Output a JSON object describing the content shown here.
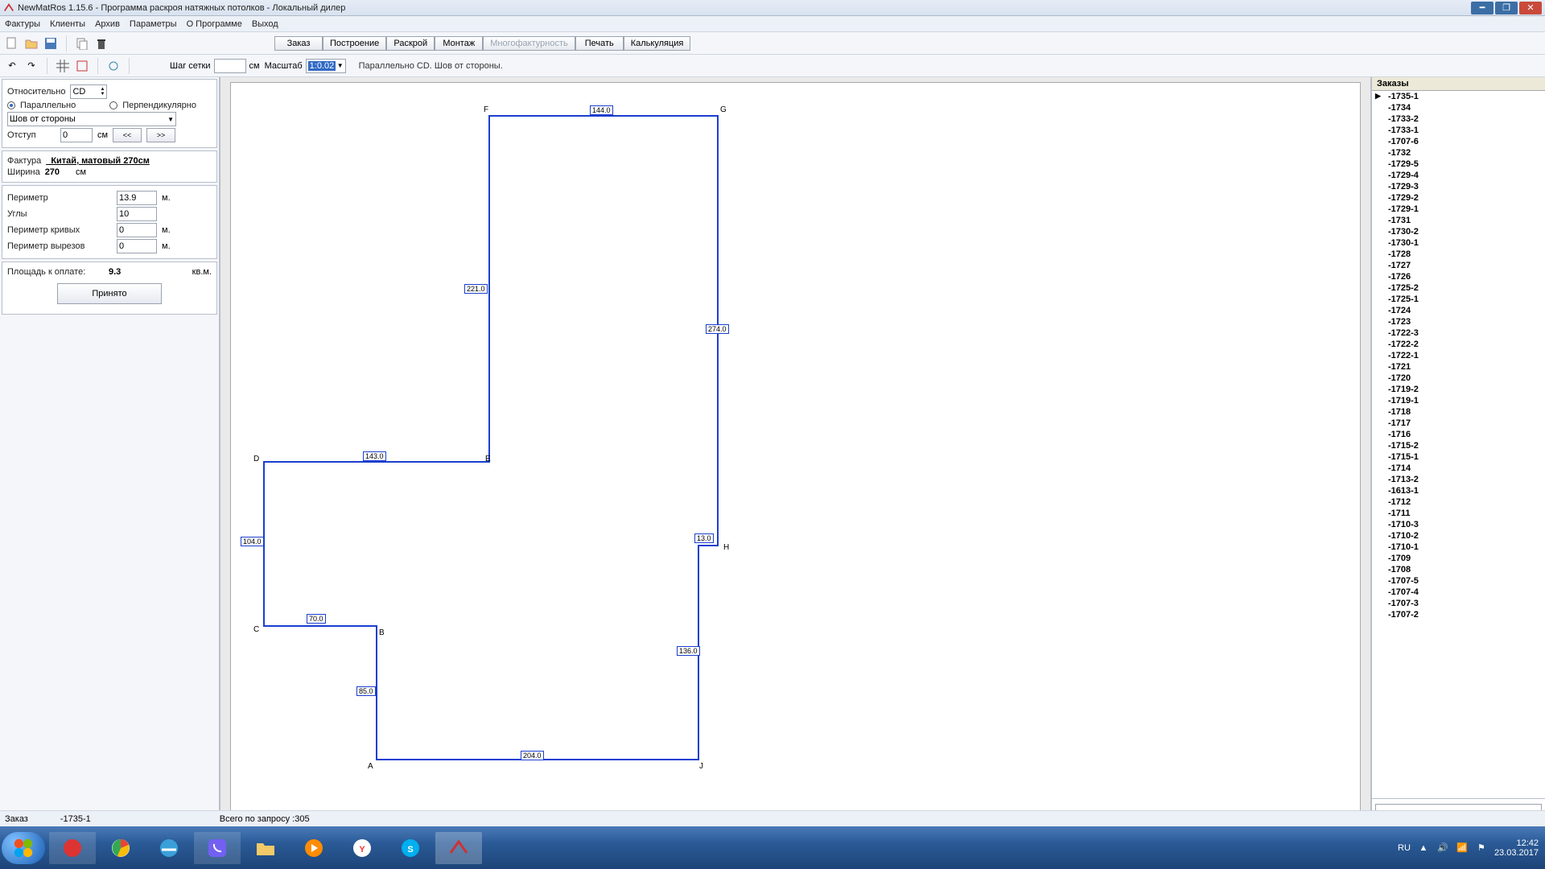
{
  "title": "NewMatRos 1.15.6 -   Программа раскроя натяжных потолков - Локальный  дилер",
  "menu": [
    "Фактуры",
    "Клиенты",
    "Архив",
    "Параметры",
    "О Программе",
    "Выход"
  ],
  "tabs": [
    "Заказ",
    "Построение",
    "Раскрой",
    "Монтаж",
    "Многофактурность",
    "Печать",
    "Калькуляция"
  ],
  "tabs_disabled_index": 4,
  "toolbar2": {
    "grid_step_label": "Шаг сетки",
    "grid_step_unit": "см",
    "scale_label": "Масштаб",
    "scale_value": "1:0.02",
    "info": "Параллельно CD. Шов от стороны."
  },
  "left": {
    "relative_label": "Относительно",
    "relative_value": "CD",
    "opt_parallel": "Параллельно",
    "opt_perp": "Перпендикулярно",
    "seam_label": "Шов от стороны",
    "offset_label": "Отступ",
    "offset_value": "0",
    "offset_unit": "см",
    "nav_prev": "<<",
    "nav_next": ">>",
    "texture_label": "Фактура",
    "texture_value": "_Китай, матовый 270см",
    "width_label": "Ширина",
    "width_value": "270",
    "width_unit": "см",
    "perimeter_label": "Периметр",
    "perimeter_value": "13.9",
    "perimeter_unit": "м.",
    "angles_label": "Углы",
    "angles_value": "10",
    "curve_label": "Периметр кривых",
    "curve_value": "0",
    "curve_unit": "м.",
    "cutout_label": "Периметр вырезов",
    "cutout_value": "0",
    "cutout_unit": "м.",
    "area_label": "Площадь к оплате:",
    "area_value": "9.3",
    "area_unit": "кв.м.",
    "accept_btn": "Принято"
  },
  "orders_header": "Заказы",
  "orders": [
    "-1735-1",
    "-1734",
    "-1733-2",
    "-1733-1",
    "-1707-6",
    "-1732",
    "-1729-5",
    "-1729-4",
    "-1729-3",
    "-1729-2",
    "-1729-1",
    "-1731",
    "-1730-2",
    "-1730-1",
    "-1728",
    "-1727",
    "-1726",
    "-1725-2",
    "-1725-1",
    "-1724",
    "-1723",
    "-1722-3",
    "-1722-2",
    "-1722-1",
    "-1721",
    "-1720",
    "-1719-2",
    "-1719-1",
    "-1718",
    "-1717",
    "-1716",
    "-1715-2",
    "-1715-1",
    "-1714",
    "-1713-2",
    "-1613-1",
    "-1712",
    "-1711",
    "-1710-3",
    "-1710-2",
    "-1710-1",
    "-1709",
    "-1708",
    "-1707-5",
    "-1707-4",
    "-1707-3",
    "-1707-2"
  ],
  "selected_order_index": 0,
  "drawing": {
    "points": {
      "A": "A",
      "B": "B",
      "C": "C",
      "D": "D",
      "E": "E",
      "F": "F",
      "G": "G",
      "H": "H",
      "J": "J"
    },
    "dims": {
      "FG": "144.0",
      "EF": "221.0",
      "GH": "274.0",
      "DE": "143.0",
      "CD": "104.0",
      "CB": "70.0",
      "BA": "85.0",
      "HJ": "136.0",
      "AJ": "204.0",
      "Hside": "13.0"
    }
  },
  "status": {
    "left_label": "Заказ",
    "order": "-1735-1",
    "total": "Всего по запросу :305"
  },
  "tray": {
    "lang": "RU",
    "time": "12:42",
    "date": "23.03.2017"
  }
}
